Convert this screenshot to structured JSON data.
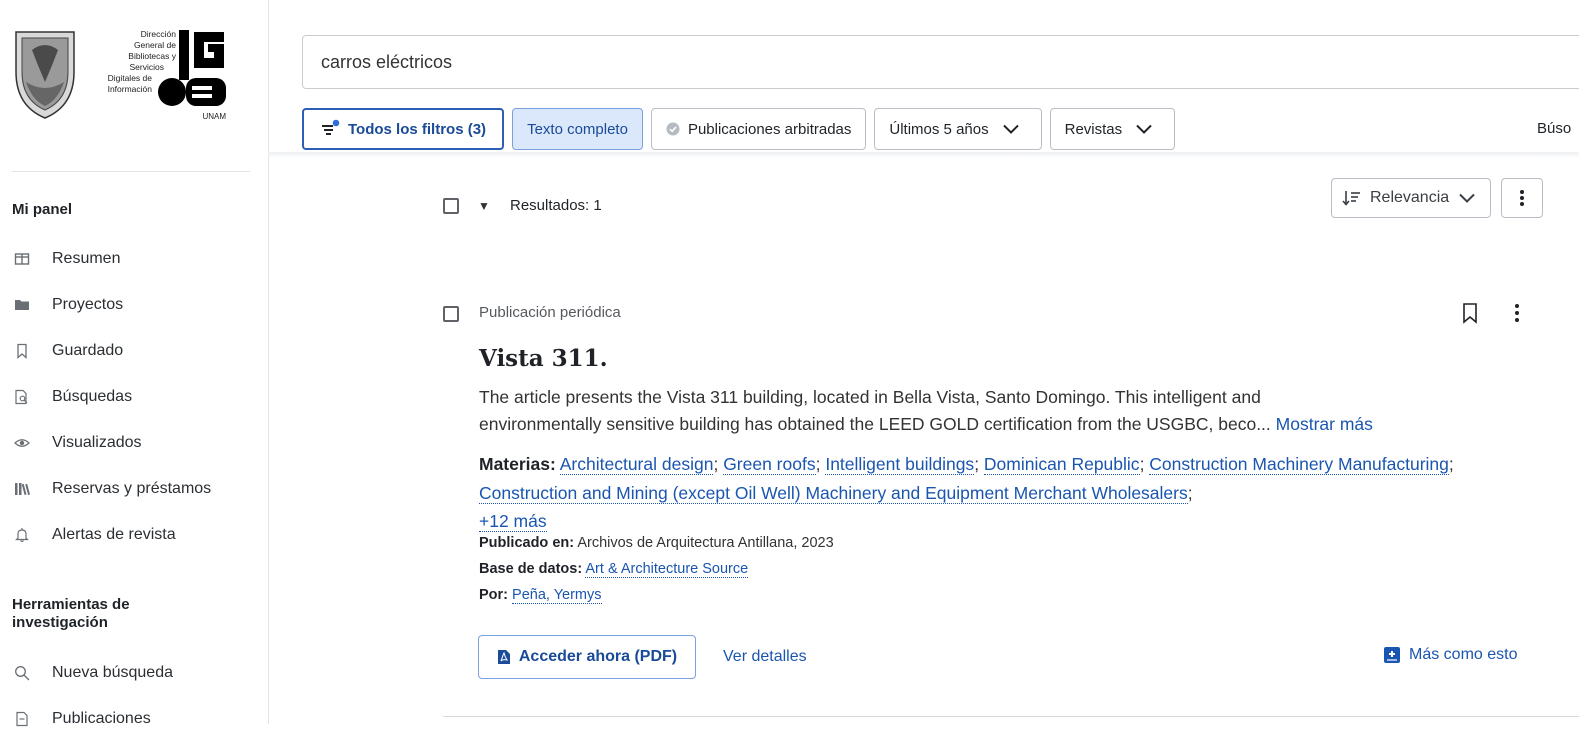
{
  "logo": {
    "text_lines": [
      "Dirección",
      "General de",
      "Bibliotecas y",
      "Servicios",
      "Digitales de",
      "Información"
    ],
    "unam": "UNAM"
  },
  "sidebar": {
    "section1_title": "Mi panel",
    "items": [
      {
        "label": "Resumen",
        "icon": "summary-icon"
      },
      {
        "label": "Proyectos",
        "icon": "folder-icon"
      },
      {
        "label": "Guardado",
        "icon": "bookmark-icon"
      },
      {
        "label": "Búsquedas",
        "icon": "saved-search-icon"
      },
      {
        "label": "Visualizados",
        "icon": "eye-icon"
      },
      {
        "label": "Reservas y préstamos",
        "icon": "library-icon"
      },
      {
        "label": "Alertas de revista",
        "icon": "bell-icon"
      }
    ],
    "section2_title_line1": "Herramientas de",
    "section2_title_line2": "investigación",
    "tools": [
      {
        "label": "Nueva búsqueda",
        "icon": "search-icon"
      },
      {
        "label": "Publicaciones",
        "icon": "document-icon"
      }
    ]
  },
  "search": {
    "query": "carros eléctricos"
  },
  "filters": {
    "all_filters": "Todos los filtros (3)",
    "full_text": "Texto completo",
    "peer_reviewed": "Publicaciones arbitradas",
    "last_years": "Últimos 5 años",
    "journals": "Revistas",
    "cut_label": "Búso"
  },
  "results": {
    "count_label": "Resultados: 1",
    "sort_label": "Relevancia"
  },
  "record": {
    "pub_type": "Publicación periódica",
    "title": "Vista 311.",
    "abstract_line1": "The article presents the Vista 311 building, located in Bella Vista, Santo Domingo. This intelligent and",
    "abstract_line2": "environmentally sensitive building has obtained the LEED GOLD certification from the USGBC, beco...",
    "show_more": "Mostrar más",
    "subjects_label": "Materias:",
    "subjects": [
      "Architectural design",
      "Green roofs",
      "Intelligent buildings",
      "Dominican Republic",
      "Construction Machinery Manufacturing",
      "Construction and Mining (except Oil Well) Machinery and Equipment Merchant Wholesalers"
    ],
    "more_subjects": "+12 más",
    "published_label": "Publicado en:",
    "published_value": "Archivos de Arquitectura Antillana, 2023",
    "database_label": "Base de datos:",
    "database_value": "Art & Architecture Source",
    "author_label": "Por:",
    "author_value": "Peña, Yermys",
    "access_button": "Acceder ahora (PDF)",
    "details_link": "Ver detalles",
    "more_like": "Más como esto"
  },
  "colors": {
    "accent": "#1a56b0",
    "active_chip_bg": "#dbe8fb"
  }
}
